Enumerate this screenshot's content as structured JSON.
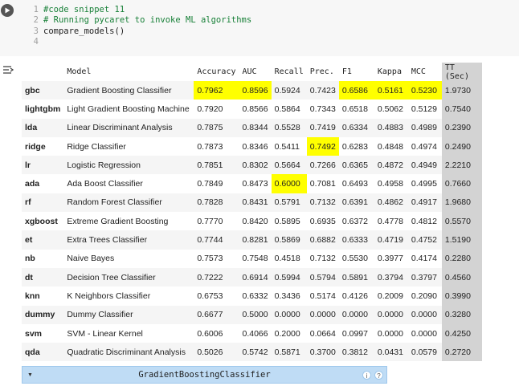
{
  "code": {
    "lines": [
      {
        "num": "1",
        "text": "#code snippet 11"
      },
      {
        "num": "2",
        "text": "# Running pycaret to invoke ML algorithms"
      },
      {
        "num": "3",
        "text": "compare_models()"
      },
      {
        "num": "4",
        "text": ""
      }
    ]
  },
  "table": {
    "headers": [
      "Model",
      "Accuracy",
      "AUC",
      "Recall",
      "Prec.",
      "F1",
      "Kappa",
      "MCC",
      "TT (Sec)"
    ],
    "rows": [
      {
        "id": "gbc",
        "model": "Gradient Boosting Classifier",
        "v": [
          "0.7962",
          "0.8596",
          "0.5924",
          "0.7423",
          "0.6586",
          "0.5161",
          "0.5230",
          "1.9730"
        ]
      },
      {
        "id": "lightgbm",
        "model": "Light Gradient Boosting Machine",
        "v": [
          "0.7920",
          "0.8566",
          "0.5864",
          "0.7343",
          "0.6518",
          "0.5062",
          "0.5129",
          "0.7540"
        ]
      },
      {
        "id": "lda",
        "model": "Linear Discriminant Analysis",
        "v": [
          "0.7875",
          "0.8344",
          "0.5528",
          "0.7419",
          "0.6334",
          "0.4883",
          "0.4989",
          "0.2390"
        ]
      },
      {
        "id": "ridge",
        "model": "Ridge Classifier",
        "v": [
          "0.7873",
          "0.8346",
          "0.5411",
          "0.7492",
          "0.6283",
          "0.4848",
          "0.4974",
          "0.2490"
        ]
      },
      {
        "id": "lr",
        "model": "Logistic Regression",
        "v": [
          "0.7851",
          "0.8302",
          "0.5664",
          "0.7266",
          "0.6365",
          "0.4872",
          "0.4949",
          "2.2210"
        ]
      },
      {
        "id": "ada",
        "model": "Ada Boost Classifier",
        "v": [
          "0.7849",
          "0.8473",
          "0.6000",
          "0.7081",
          "0.6493",
          "0.4958",
          "0.4995",
          "0.7660"
        ]
      },
      {
        "id": "rf",
        "model": "Random Forest Classifier",
        "v": [
          "0.7828",
          "0.8431",
          "0.5791",
          "0.7132",
          "0.6391",
          "0.4862",
          "0.4917",
          "1.9680"
        ]
      },
      {
        "id": "xgboost",
        "model": "Extreme Gradient Boosting",
        "v": [
          "0.7770",
          "0.8420",
          "0.5895",
          "0.6935",
          "0.6372",
          "0.4778",
          "0.4812",
          "0.5570"
        ]
      },
      {
        "id": "et",
        "model": "Extra Trees Classifier",
        "v": [
          "0.7744",
          "0.8281",
          "0.5869",
          "0.6882",
          "0.6333",
          "0.4719",
          "0.4752",
          "1.5190"
        ]
      },
      {
        "id": "nb",
        "model": "Naive Bayes",
        "v": [
          "0.7573",
          "0.7548",
          "0.4518",
          "0.7132",
          "0.5530",
          "0.3977",
          "0.4174",
          "0.2280"
        ]
      },
      {
        "id": "dt",
        "model": "Decision Tree Classifier",
        "v": [
          "0.7222",
          "0.6914",
          "0.5994",
          "0.5794",
          "0.5891",
          "0.3794",
          "0.3797",
          "0.4560"
        ]
      },
      {
        "id": "knn",
        "model": "K Neighbors Classifier",
        "v": [
          "0.6753",
          "0.6332",
          "0.3436",
          "0.5174",
          "0.4126",
          "0.2009",
          "0.2090",
          "0.3990"
        ]
      },
      {
        "id": "dummy",
        "model": "Dummy Classifier",
        "v": [
          "0.6677",
          "0.5000",
          "0.0000",
          "0.0000",
          "0.0000",
          "0.0000",
          "0.0000",
          "0.3280"
        ]
      },
      {
        "id": "svm",
        "model": "SVM - Linear Kernel",
        "v": [
          "0.6006",
          "0.4066",
          "0.2000",
          "0.0664",
          "0.0997",
          "0.0000",
          "0.0000",
          "0.4250"
        ]
      },
      {
        "id": "qda",
        "model": "Quadratic Discriminant Analysis",
        "v": [
          "0.5026",
          "0.5742",
          "0.5871",
          "0.3700",
          "0.3812",
          "0.0431",
          "0.0579",
          "0.2720"
        ]
      }
    ],
    "highlight_color": "#ffff00",
    "tt_color": "#d3d3d3",
    "highlights": [
      {
        "row": 0,
        "col": 0
      },
      {
        "row": 0,
        "col": 1
      },
      {
        "row": 0,
        "col": 4
      },
      {
        "row": 0,
        "col": 5
      },
      {
        "row": 0,
        "col": 6
      },
      {
        "row": 3,
        "col": 3
      },
      {
        "row": 5,
        "col": 2
      }
    ]
  },
  "widget": {
    "title": "GradientBoostingClassifier",
    "icons": [
      "info-icon",
      "help-icon"
    ]
  }
}
